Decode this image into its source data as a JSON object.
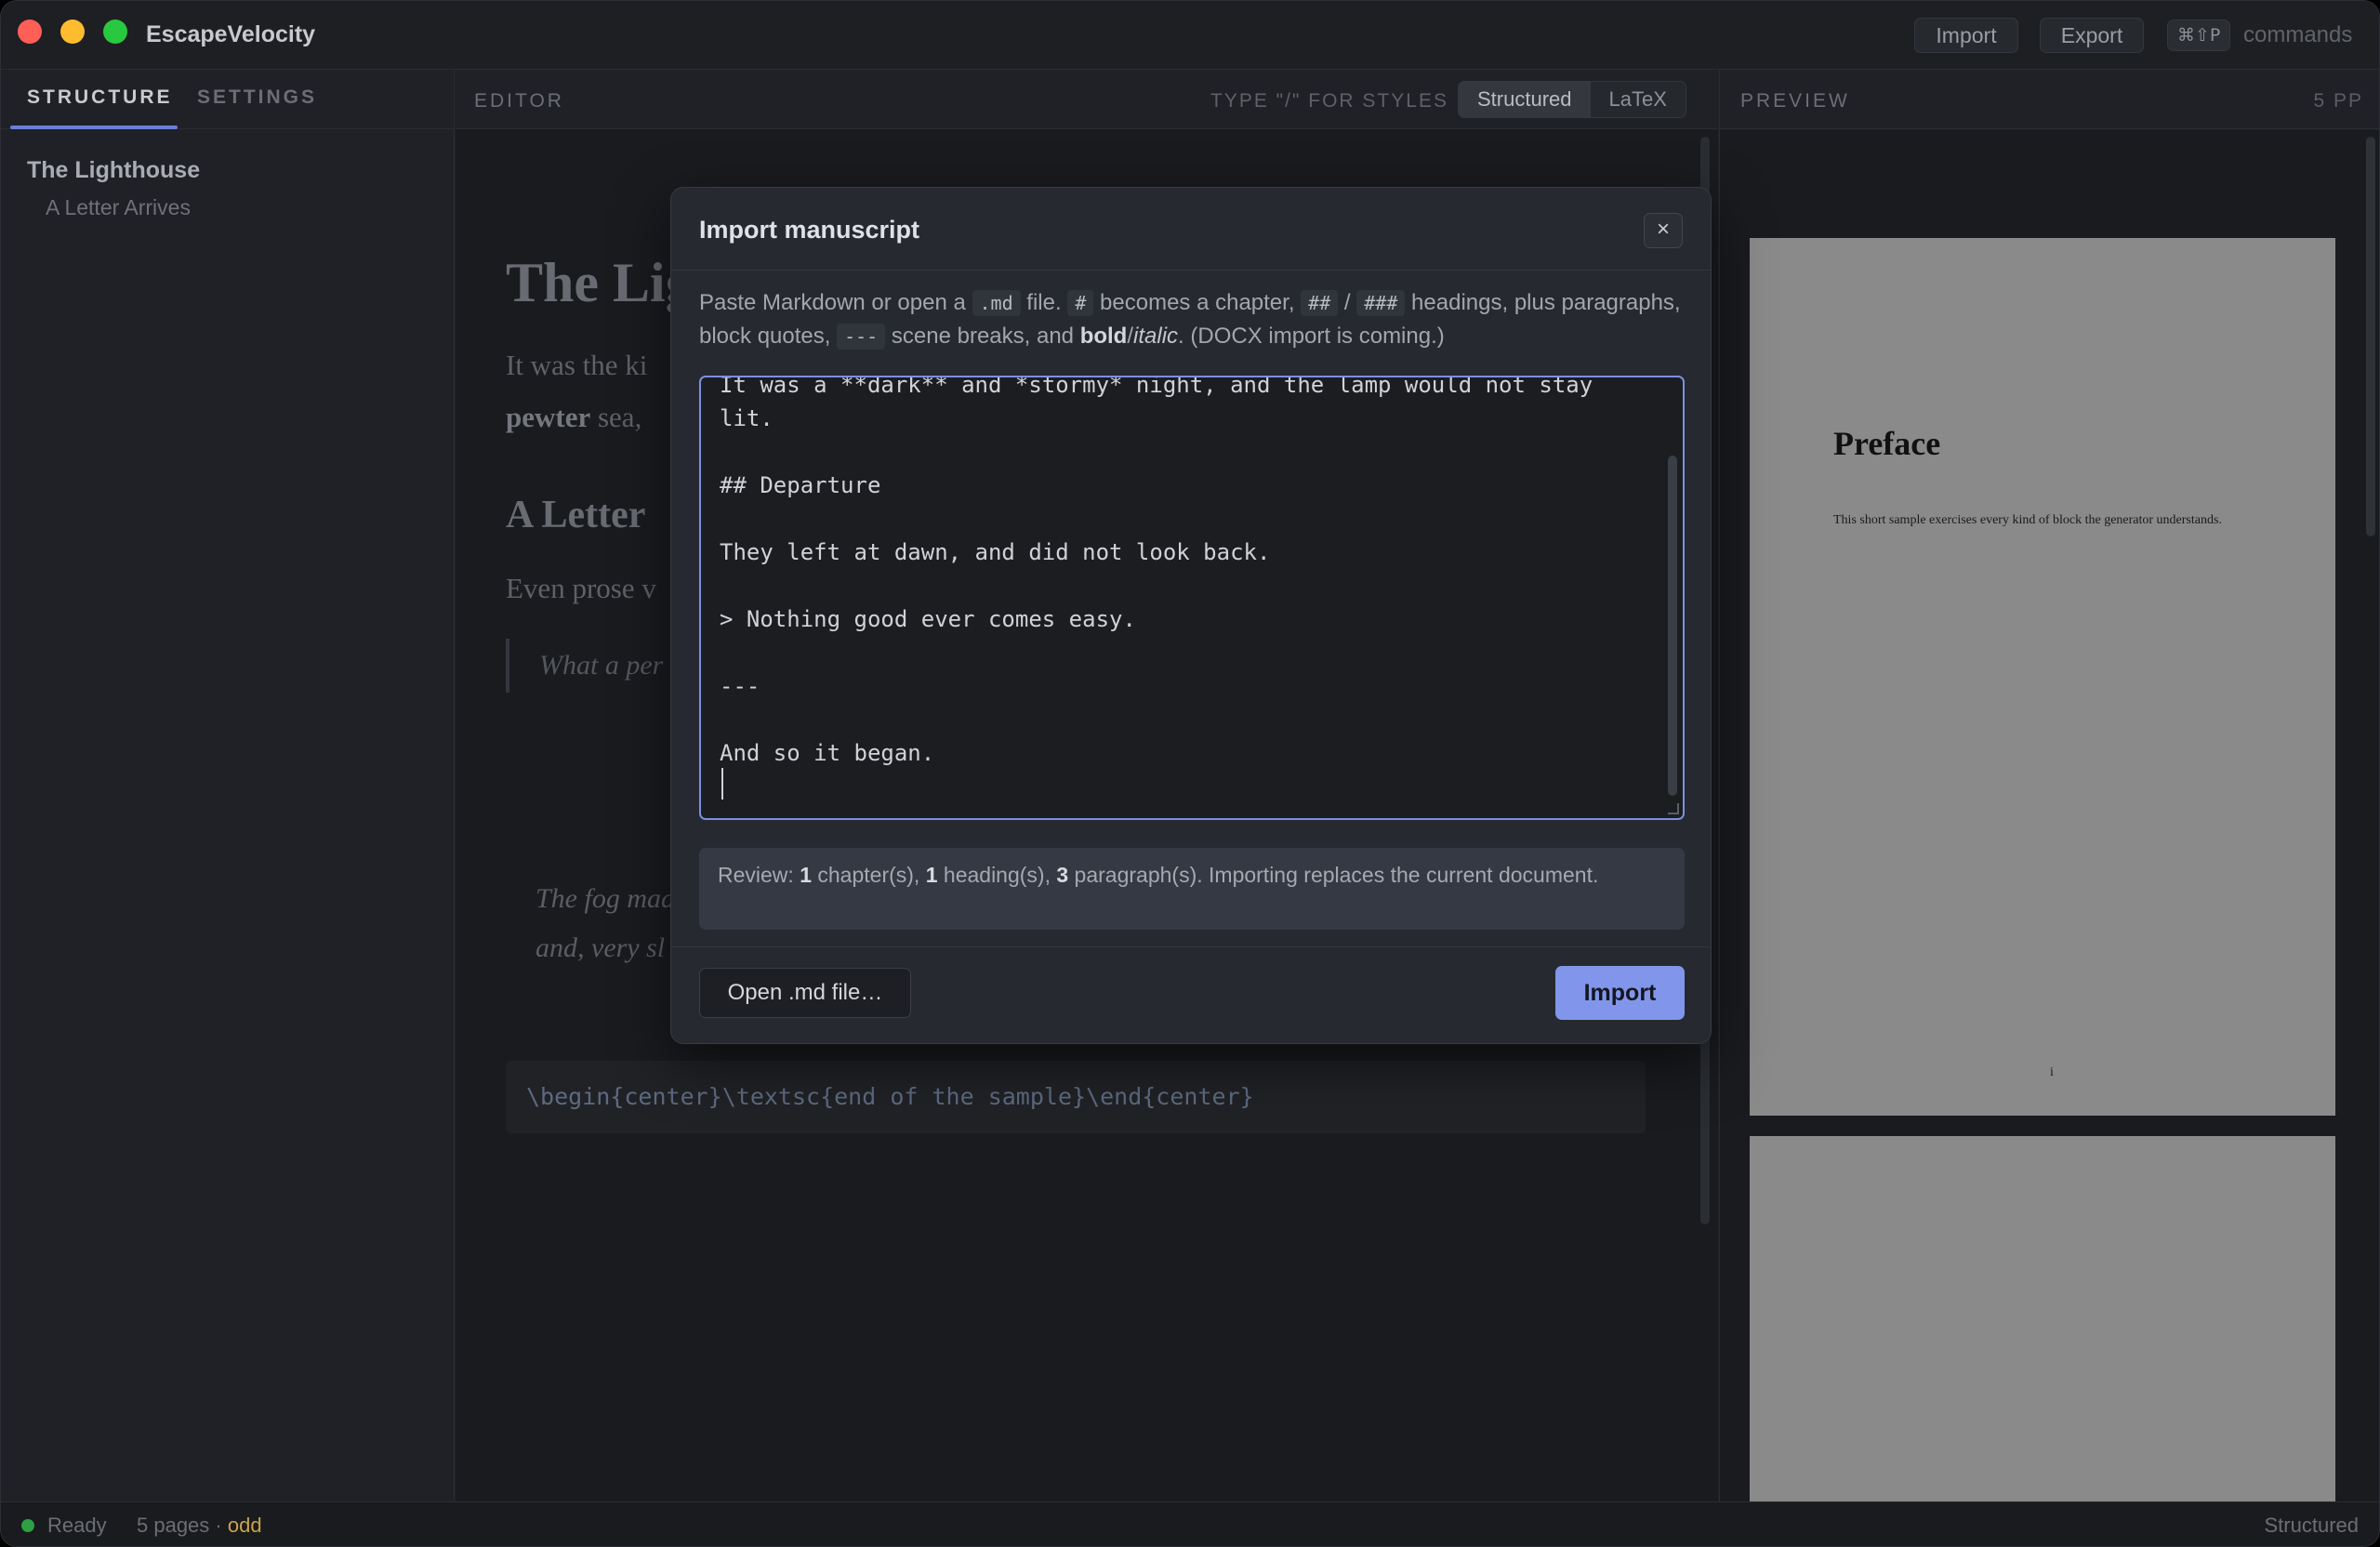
{
  "window": {
    "app_title": "EscapeVelocity",
    "import_label": "Import",
    "export_label": "Export",
    "shortcut": "⌘⇧P",
    "commands_label": "commands"
  },
  "sidebar": {
    "tabs": [
      {
        "label": "STRUCTURE",
        "active": true
      },
      {
        "label": "SETTINGS",
        "active": false
      }
    ],
    "outline": {
      "chapter": "The Lighthouse",
      "heading": "A Letter Arrives"
    }
  },
  "editor": {
    "label": "EDITOR",
    "hint": "TYPE \"/\" FOR STYLES",
    "modes": [
      {
        "label": "Structured",
        "active": true
      },
      {
        "label": "LaTeX",
        "active": false
      }
    ],
    "visible": {
      "title": "The Lig",
      "p1": "It was the ki",
      "p2_bold": "pewter",
      "p2_rest": " sea,",
      "h2": "A Letter",
      "p3": "Even prose v",
      "quote": "What a per",
      "ital1": "The fog mad",
      "ital2": "and, very sl",
      "code": "\\begin{center}\\textsc{end of the sample}\\end{center}"
    }
  },
  "preview": {
    "label": "PREVIEW",
    "page_count": "5 PP",
    "page1": {
      "title": "Preface",
      "text": "This short sample exercises every kind of block the generator understands.",
      "number": "i"
    }
  },
  "statusbar": {
    "ready": "Ready",
    "pages": "5 pages",
    "separator": " · ",
    "parity": "odd",
    "mode": "Structured",
    "status_color": "#2ea043"
  },
  "modal": {
    "title": "Import manuscript",
    "close": "×",
    "desc": {
      "t1": "Paste Markdown or open a ",
      "c1": ".md",
      "t2": " file. ",
      "c2": "#",
      "t3": " becomes a chapter, ",
      "c3": "##",
      "t4": " / ",
      "c4": "###",
      "t5": " headings, plus paragraphs, block quotes, ",
      "c5": "---",
      "t6": " scene breaks, and ",
      "bold": "bold",
      "slash": "/",
      "ital": "italic",
      "t7": ". (DOCX import is coming.)"
    },
    "markdown_lines": [
      "It was a **dark** and *stormy* night, and the lamp would not stay",
      "lit.",
      "",
      "## Departure",
      "",
      "They left at dawn, and did not look back.",
      "",
      "> Nothing good ever comes easy.",
      "",
      "---",
      "",
      "And so it began."
    ],
    "review": {
      "prefix": "Review: ",
      "chapters": "1",
      "chapters_label": " chapter(s), ",
      "headings": "1",
      "headings_label": " heading(s), ",
      "paragraphs": "3",
      "paragraphs_label": " paragraph(s). Importing replaces the current document."
    },
    "open_label": "Open .md file…",
    "import_label": "Import",
    "accent": "#8196ea"
  }
}
